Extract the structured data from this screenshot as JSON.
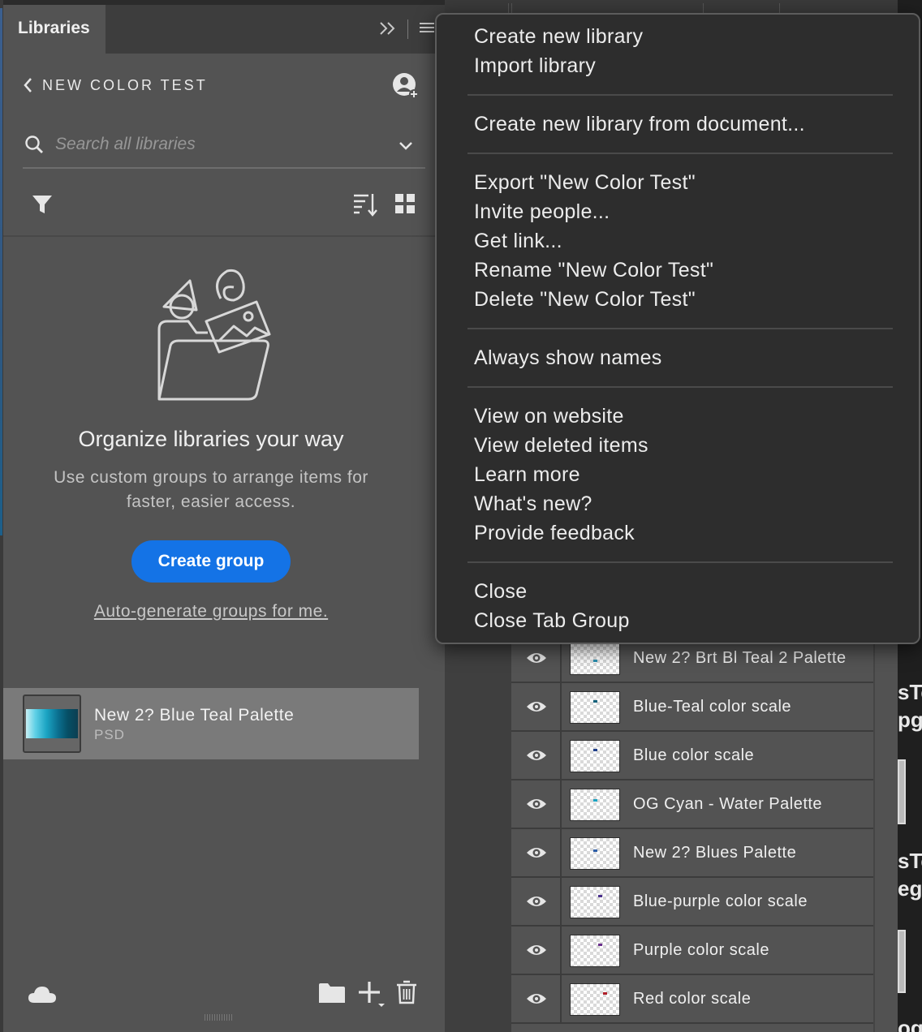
{
  "panel": {
    "tab_label": "Libraries",
    "collapse_icon": "double-chevron-right-icon",
    "menu_icon": "hamburger-menu-icon"
  },
  "library": {
    "name": "NEW COLOR TEST",
    "back_icon": "chevron-left-icon",
    "invite_icon": "add-user-icon"
  },
  "search": {
    "placeholder": "Search all libraries",
    "value": ""
  },
  "toolbar": {
    "filter_icon": "filter-icon",
    "sort_icon": "sort-icon",
    "view_icon": "grid-view-icon"
  },
  "empty_state": {
    "illustration": "folder-with-assets-illustration",
    "title": "Organize libraries your way",
    "description": "Use custom groups to arrange items for faster, easier access.",
    "button_label": "Create group",
    "link_label": "Auto-generate groups for me."
  },
  "assets": [
    {
      "name": "New 2? Blue Teal Palette",
      "type": "PSD"
    }
  ],
  "footer": {
    "icons": [
      "cloud-icon",
      "folder-icon",
      "add-icon",
      "trash-icon"
    ]
  },
  "flyout_menu": {
    "groups": [
      [
        "Create new library",
        "Import library"
      ],
      [
        "Create new library from document..."
      ],
      [
        "Export \"New Color Test\"",
        "Invite people...",
        "Get link...",
        "Rename \"New Color Test\"",
        "Delete \"New Color Test\""
      ],
      [
        "Always show names"
      ],
      [
        "View on website",
        "View deleted items",
        "Learn more",
        "What's new?",
        "Provide feedback"
      ],
      [
        "Close",
        "Close Tab Group"
      ]
    ]
  },
  "layers": [
    {
      "name": "New 2? Brt Bl Teal 2 Palette",
      "swatch": "#2b8fb0"
    },
    {
      "name": "Blue-Teal color scale",
      "swatch": "#11607a"
    },
    {
      "name": "Blue color scale",
      "swatch": "#1f3f8a"
    },
    {
      "name": "OG Cyan - Water Palette",
      "swatch": "#1aa3c2"
    },
    {
      "name": "New 2? Blues Palette",
      "swatch": "#2e5fa8"
    },
    {
      "name": "Blue-purple color scale",
      "swatch": "#4a2f8c"
    },
    {
      "name": "Purple color scale",
      "swatch": "#6b2f8c"
    },
    {
      "name": "Red color scale",
      "swatch": "#b0202a"
    }
  ],
  "document_strip": {
    "fragments": [
      "sTe",
      "pg",
      "sTe",
      "eg",
      "og"
    ]
  },
  "colors": {
    "panel_bg": "#535353",
    "menu_bg": "#2d2d2d",
    "accent": "#1473e6"
  }
}
